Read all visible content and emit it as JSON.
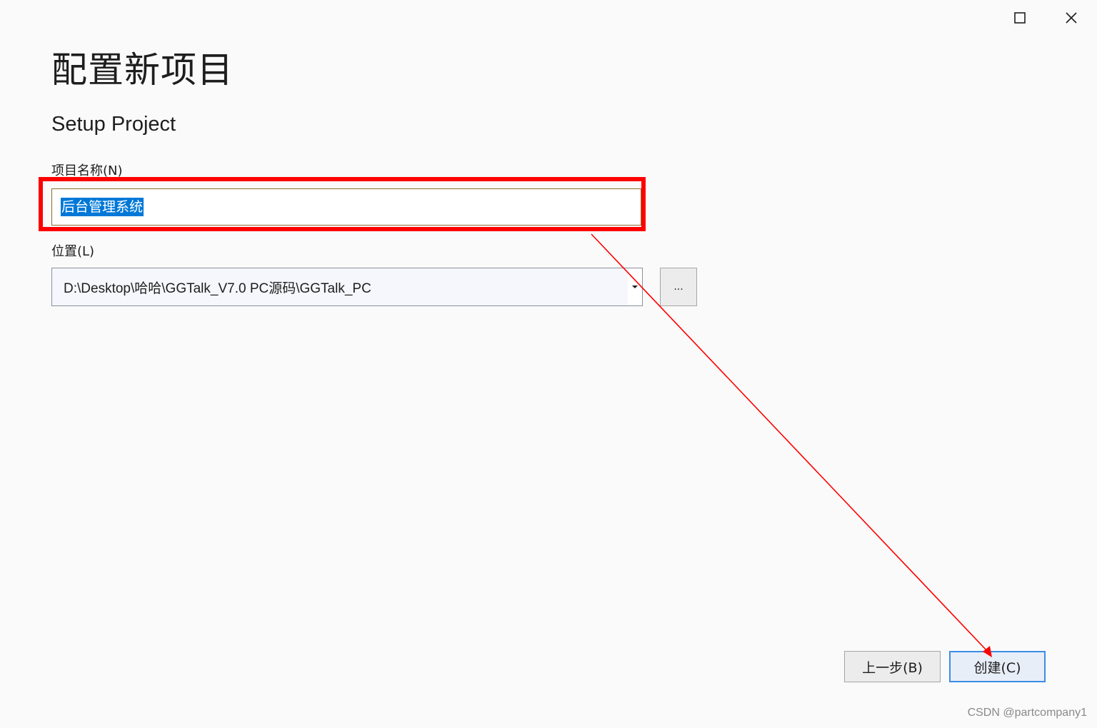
{
  "window_controls": {
    "maximize_icon": "maximize-icon",
    "close_icon": "close-icon"
  },
  "header": {
    "title": "配置新项目",
    "template_name": "Setup Project"
  },
  "form": {
    "name_label": "项目名称(N)",
    "name_value": "后台管理系统",
    "location_label": "位置(L)",
    "location_value": "D:\\Desktop\\哈哈\\GGTalk_V7.0 PC源码\\GGTalk_PC",
    "browse_label": "..."
  },
  "footer": {
    "back_label": "上一步(B)",
    "create_label": "创建(C)"
  },
  "annotation": {
    "highlight_color": "#ff0000",
    "arrow_color": "#ff0000"
  },
  "watermark": "CSDN @partcompany1",
  "colors": {
    "selection": "#0078d7",
    "create_border": "#3c8ce6"
  }
}
